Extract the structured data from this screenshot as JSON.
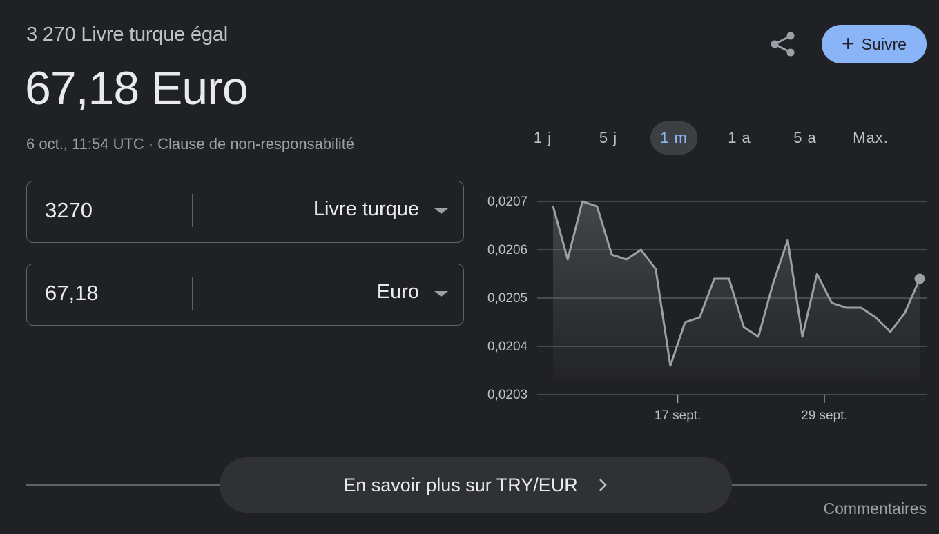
{
  "header": {
    "subtitle": "3 270 Livre turque égal",
    "result": "67,18 Euro",
    "timestamp": "6 oct., 11:54 UTC",
    "separator": "·",
    "disclaimer": "Clause de non-responsabilité"
  },
  "actions": {
    "share_icon": "share-icon",
    "follow_label": "Suivre",
    "follow_icon": "+"
  },
  "ranges": [
    {
      "label": "1 j",
      "active": false
    },
    {
      "label": "5 j",
      "active": false
    },
    {
      "label": "1 m",
      "active": true
    },
    {
      "label": "1 a",
      "active": false
    },
    {
      "label": "5 a",
      "active": false
    },
    {
      "label": "Max.",
      "active": false
    }
  ],
  "converter": {
    "from_value": "3270",
    "from_currency": "Livre turque",
    "to_value": "67,18",
    "to_currency": "Euro"
  },
  "chart_data": {
    "type": "area",
    "title": "",
    "xlabel": "",
    "ylabel": "",
    "ylim": [
      0.0203,
      0.0207
    ],
    "yticks": [
      "0,0207",
      "0,0206",
      "0,0205",
      "0,0204",
      "0,0203"
    ],
    "yticks_values": [
      0.0207,
      0.0206,
      0.0205,
      0.0204,
      0.0203
    ],
    "xticks": [
      "17 sept.",
      "29 sept."
    ],
    "xticks_index": [
      8.5,
      18.5
    ],
    "grid": true,
    "series": [
      {
        "values": [
          0.02069,
          0.02058,
          0.0207,
          0.02069,
          0.02059,
          0.02058,
          0.0206,
          0.02056,
          0.02036,
          0.02045,
          0.02046,
          0.02054,
          0.02054,
          0.02044,
          0.02042,
          0.02053,
          0.02062,
          0.02042,
          0.02055,
          0.02049,
          0.02048,
          0.02048,
          0.02046,
          0.02043,
          0.02047,
          0.02054
        ]
      }
    ],
    "line_color": "#9aa0a6",
    "grid_color": "#5f6368"
  },
  "footer": {
    "learn_more": "En savoir plus sur TRY/EUR",
    "feedback": "Commentaires"
  }
}
